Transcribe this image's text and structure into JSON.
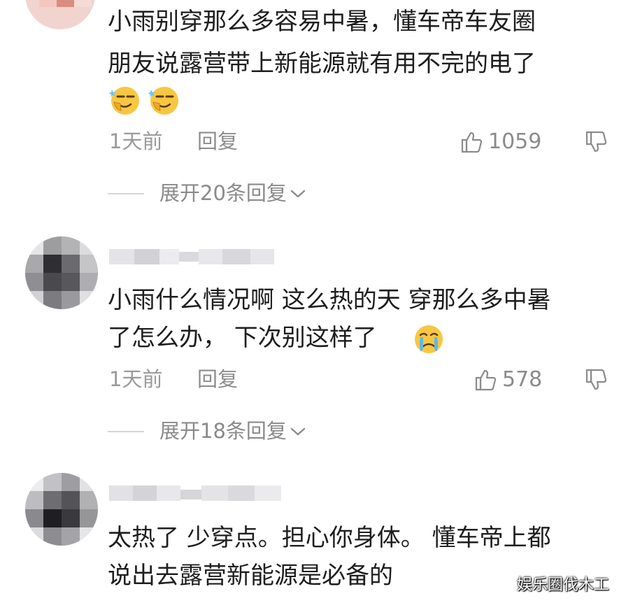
{
  "comments": [
    {
      "text_lines": [
        "小雨别穿那么多容易中暑，懂车帝车友圈",
        "朋友说露营带上新能源就有用不完的电了"
      ],
      "emojis": [
        "smirk-emoji",
        "smirk-emoji"
      ],
      "time": "1天前",
      "reply_label": "回复",
      "likes": "1059",
      "expand_label": "展开20条回复"
    },
    {
      "text_lines": [
        "小雨什么情况啊 这么热的天 穿那么多中暑",
        "了怎么办， 下次别这样了"
      ],
      "emojis": [
        "crying-emoji"
      ],
      "time": "1天前",
      "reply_label": "回复",
      "likes": "578",
      "expand_label": "展开18条回复"
    },
    {
      "text_lines": [
        "太热了 少穿点。担心你身体。 懂车帝上都",
        "说出去露营新能源是必备的"
      ]
    }
  ],
  "watermark": "娱乐圈伐木工",
  "colors": {
    "text": "#1e1e1e",
    "meta": "#9a9a9a",
    "emoji_yellow": "#f7c743"
  }
}
